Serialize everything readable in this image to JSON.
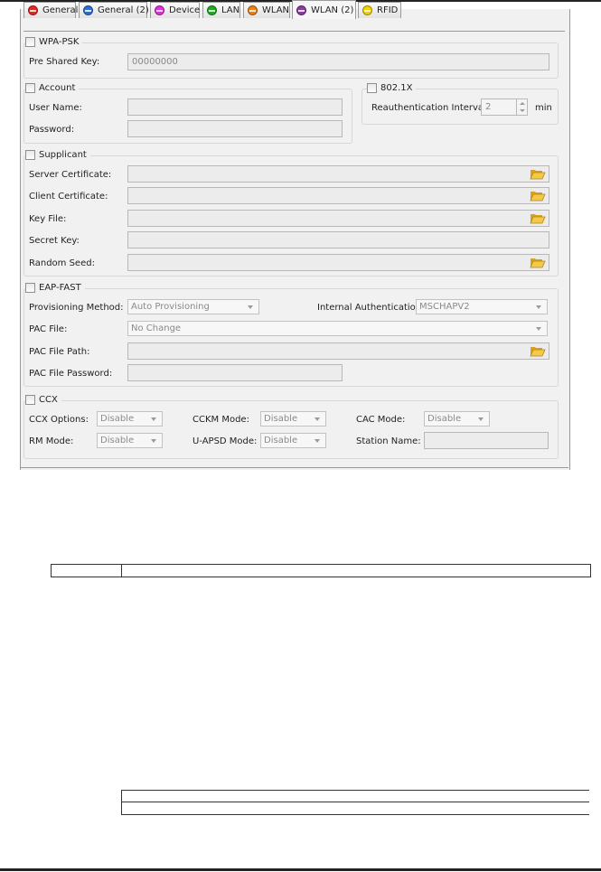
{
  "tabs": [
    {
      "label": "General",
      "color": "#e32626"
    },
    {
      "label": "General (2)",
      "color": "#2a6fd6"
    },
    {
      "label": "Device",
      "color": "#e02ee0"
    },
    {
      "label": "LAN",
      "color": "#1faa1f"
    },
    {
      "label": "WLAN",
      "color": "#f07f10"
    },
    {
      "label": "WLAN (2)",
      "color": "#8c3aa4",
      "active": true
    },
    {
      "label": "RFID",
      "color": "#f2d100"
    }
  ],
  "wpa_psk": {
    "title": "WPA-PSK",
    "pre_shared_key_label": "Pre Shared Key:",
    "pre_shared_key_value": "00000000"
  },
  "account": {
    "title": "Account",
    "user_name_label": "User Name:",
    "password_label": "Password:"
  },
  "dot1x": {
    "title": "802.1X",
    "reauth_label": "Reauthentication Interval:",
    "reauth_value": "2",
    "unit": "min"
  },
  "supplicant": {
    "title": "Supplicant",
    "server_cert_label": "Server Certificate:",
    "client_cert_label": "Client Certificate:",
    "key_file_label": "Key File:",
    "secret_key_label": "Secret Key:",
    "random_seed_label": "Random Seed:"
  },
  "eap_fast": {
    "title": "EAP-FAST",
    "provisioning_label": "Provisioning Method:",
    "provisioning_value": "Auto Provisioning",
    "internal_auth_label": "Internal Authentication:",
    "internal_auth_value": "MSCHAPV2",
    "pac_file_label": "PAC File:",
    "pac_file_value": "No Change",
    "pac_file_path_label": "PAC File Path:",
    "pac_file_password_label": "PAC File Password:"
  },
  "ccx": {
    "title": "CCX",
    "ccx_options_label": "CCX Options:",
    "ccx_options_value": "Disable",
    "cckm_mode_label": "CCKM Mode:",
    "cckm_mode_value": "Disable",
    "cac_mode_label": "CAC Mode:",
    "cac_mode_value": "Disable",
    "rm_mode_label": "RM Mode:",
    "rm_mode_value": "Disable",
    "uapsd_mode_label": "U-APSD Mode:",
    "uapsd_mode_value": "Disable",
    "station_name_label": "Station Name:"
  }
}
